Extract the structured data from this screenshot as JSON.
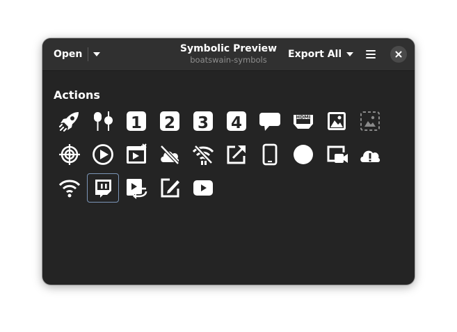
{
  "header": {
    "open_label": "Open",
    "title": "Symbolic Preview",
    "subtitle": "boatswain-symbols",
    "export_label": "Export All"
  },
  "section": {
    "title": "Actions"
  },
  "icons": [
    "rocket-icon",
    "microphones-icon",
    "number-1-icon",
    "number-2-icon",
    "number-3-icon",
    "number-4-icon",
    "speech-bubble-icon",
    "hdmi-icon",
    "image-icon",
    "image-missing-icon",
    "target-icon",
    "play-circle-icon",
    "video-window-icon",
    "cloud-disabled-icon",
    "wifi-disabled-icon",
    "external-link-icon",
    "phone-icon",
    "circle-icon",
    "screen-record-icon",
    "cloud-warning-icon",
    "wifi-icon",
    "twitch-icon",
    "switch-scene-icon",
    "edit-icon",
    "youtube-icon"
  ],
  "selected_icon": "twitch-icon",
  "colors": {
    "window_bg": "#242424",
    "header_bg": "#303030",
    "selection": "#7c96b8"
  }
}
